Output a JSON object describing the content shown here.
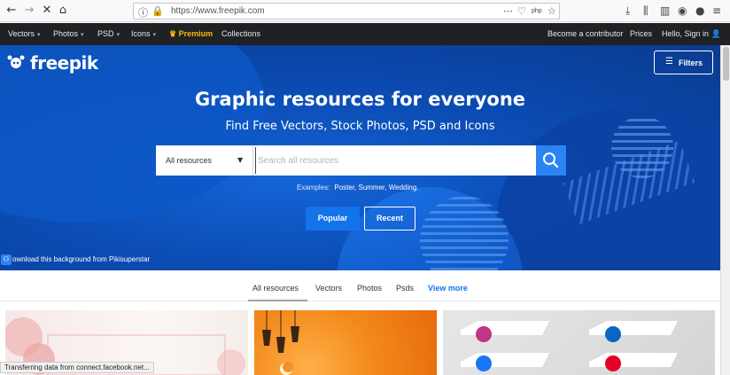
{
  "browser": {
    "url": "https://www.freepik.com",
    "back_icon": "arrow-left-icon",
    "forward_icon": "arrow-right-icon",
    "stop_icon": "close-icon",
    "home_icon": "home-icon",
    "page_actions_icon": "ellipsis-icon",
    "pocket_icon": "pocket-icon",
    "bookmark_icon": "star-icon",
    "extension_label": "php"
  },
  "site_nav": {
    "left": [
      {
        "label": "Vectors",
        "dropdown": true
      },
      {
        "label": "Photos",
        "dropdown": true
      },
      {
        "label": "PSD",
        "dropdown": true
      },
      {
        "label": "Icons",
        "dropdown": true
      },
      {
        "label": "Premium",
        "dropdown": false
      },
      {
        "label": "Collections",
        "dropdown": false
      }
    ],
    "right": [
      {
        "label": "Become a contributor"
      },
      {
        "label": "Prices"
      },
      {
        "label": "Hello, Sign in"
      }
    ],
    "premium_color": "#fcb900"
  },
  "hero": {
    "logo_text": "freepik",
    "filters_label": "Filters",
    "title": "Graphic resources for everyone",
    "subtitle": "Find Free Vectors, Stock Photos, PSD and Icons",
    "search": {
      "category_label": "All resources",
      "placeholder": "Search all resources"
    },
    "examples_lead": "Examples:",
    "examples_text": "Poster, Summer, Wedding.",
    "btn_popular": "Popular",
    "btn_recent": "Recent",
    "credit_text": "ownload this background from Pikisuperstar"
  },
  "tabs": [
    {
      "label": "All resources",
      "active": true
    },
    {
      "label": "Vectors",
      "active": false
    },
    {
      "label": "Photos",
      "active": false
    },
    {
      "label": "Psds",
      "active": false
    },
    {
      "label": "View more",
      "active": false
    }
  ],
  "status_text": "Transferring data from connect.facebook.net...",
  "colors": {
    "accent": "#1273eb",
    "hero_blue": "#0b4cb4",
    "nav_bg": "#1f2124"
  }
}
